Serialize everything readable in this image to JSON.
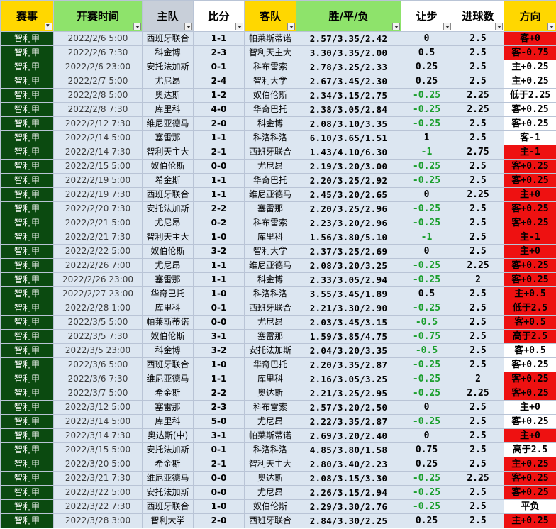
{
  "headers": [
    {
      "label": "赛事",
      "bg": "yellow",
      "filter": "active"
    },
    {
      "label": "开赛时间",
      "bg": "green",
      "filter": "normal"
    },
    {
      "label": "主队",
      "bg": "gray",
      "filter": "normal"
    },
    {
      "label": "比分",
      "bg": "white",
      "filter": "normal"
    },
    {
      "label": "客队",
      "bg": "yellow",
      "filter": "normal"
    },
    {
      "label": "胜/平/负",
      "bg": "green",
      "filter": "normal"
    },
    {
      "label": "让步",
      "bg": "white",
      "filter": "normal"
    },
    {
      "label": "进球数",
      "bg": "white",
      "filter": "normal"
    },
    {
      "label": "方向",
      "bg": "yellow",
      "filter": "normal"
    }
  ],
  "colors": {
    "league_bg": "#0b4a10",
    "row_bg": "#dce6f1",
    "dir_red": "#ee1111",
    "handicap_negative": "#1a9e2c"
  },
  "rows": [
    [
      "智利甲",
      "2022/2/6 5:00",
      "西班牙联合",
      "1-1",
      "帕莱斯蒂诺",
      "2.57/3.35/2.42",
      "0",
      "2.5",
      "客+0",
      "red"
    ],
    [
      "智利甲",
      "2022/2/6 7:30",
      "科金博",
      "2-3",
      "智利天主大",
      "3.30/3.35/2.00",
      "0.5",
      "2.5",
      "客-0.75",
      "red"
    ],
    [
      "智利甲",
      "2022/2/6 23:00",
      "安托法加斯",
      "0-1",
      "科布雷索",
      "2.78/3.25/2.33",
      "0.25",
      "2.5",
      "主+0.25",
      "white"
    ],
    [
      "智利甲",
      "2022/2/7 5:00",
      "尤尼昂",
      "2-4",
      "智利大学",
      "2.67/3.45/2.30",
      "0.25",
      "2.5",
      "主+0.25",
      "white"
    ],
    [
      "智利甲",
      "2022/2/8 5:00",
      "奥达斯",
      "1-2",
      "奴伯伦斯",
      "2.34/3.15/2.75",
      "-0.25",
      "2.25",
      "低于2.25",
      "white"
    ],
    [
      "智利甲",
      "2022/2/8 7:30",
      "库里科",
      "4-0",
      "华奇巴托",
      "2.38/3.05/2.84",
      "-0.25",
      "2.25",
      "客+0.25",
      "white"
    ],
    [
      "智利甲",
      "2022/2/12 7:30",
      "维尼亚德马",
      "2-0",
      "科金博",
      "2.08/3.10/3.35",
      "-0.25",
      "2.5",
      "客+0.25",
      "white"
    ],
    [
      "智利甲",
      "2022/2/14 5:00",
      "塞雷那",
      "1-1",
      "科洛科洛",
      "6.10/3.65/1.51",
      "1",
      "2.5",
      "客-1",
      "white"
    ],
    [
      "智利甲",
      "2022/2/14 7:30",
      "智利天主大",
      "2-1",
      "西班牙联合",
      "1.43/4.10/6.30",
      "-1",
      "2.75",
      "主-1",
      "red"
    ],
    [
      "智利甲",
      "2022/2/15 5:00",
      "奴伯伦斯",
      "0-0",
      "尤尼昂",
      "2.19/3.20/3.00",
      "-0.25",
      "2.5",
      "客+0.25",
      "red"
    ],
    [
      "智利甲",
      "2022/2/19 5:00",
      "希金斯",
      "1-1",
      "华奇巴托",
      "2.20/3.25/2.92",
      "-0.25",
      "2.5",
      "客+0.25",
      "red"
    ],
    [
      "智利甲",
      "2022/2/19 7:30",
      "西班牙联合",
      "1-1",
      "维尼亚德马",
      "2.45/3.20/2.65",
      "0",
      "2.25",
      "主+0",
      "red"
    ],
    [
      "智利甲",
      "2022/2/20 7:30",
      "安托法加斯",
      "2-2",
      "塞雷那",
      "2.20/3.25/2.96",
      "-0.25",
      "2.5",
      "客+0.25",
      "red"
    ],
    [
      "智利甲",
      "2022/2/21 5:00",
      "尤尼昂",
      "0-2",
      "科布雷索",
      "2.23/3.20/2.96",
      "-0.25",
      "2.5",
      "客+0.25",
      "red"
    ],
    [
      "智利甲",
      "2022/2/21 7:30",
      "智利天主大",
      "1-0",
      "库里科",
      "1.56/3.80/5.10",
      "-1",
      "2.5",
      "主-1",
      "red"
    ],
    [
      "智利甲",
      "2022/2/22 5:00",
      "奴伯伦斯",
      "3-2",
      "智利大学",
      "2.37/3.25/2.69",
      "0",
      "2.5",
      "主+0",
      "red"
    ],
    [
      "智利甲",
      "2022/2/26 7:00",
      "尤尼昂",
      "1-1",
      "维尼亚德马",
      "2.08/3.20/3.25",
      "-0.25",
      "2.25",
      "客+0.25",
      "red"
    ],
    [
      "智利甲",
      "2022/2/26 23:00",
      "塞雷那",
      "1-1",
      "科金博",
      "2.33/3.05/2.94",
      "-0.25",
      "2",
      "客+0.25",
      "red"
    ],
    [
      "智利甲",
      "2022/2/27 23:00",
      "华奇巴托",
      "1-0",
      "科洛科洛",
      "3.55/3.45/1.89",
      "0.5",
      "2.5",
      "主+0.5",
      "red"
    ],
    [
      "智利甲",
      "2022/2/28 1:00",
      "库里科",
      "0-1",
      "西班牙联合",
      "2.21/3.30/2.90",
      "-0.25",
      "2.5",
      "低于2.5",
      "red"
    ],
    [
      "智利甲",
      "2022/3/5 5:00",
      "帕莱斯蒂诺",
      "0-0",
      "尤尼昂",
      "2.03/3.45/3.15",
      "-0.5",
      "2.5",
      "客+0.5",
      "red"
    ],
    [
      "智利甲",
      "2022/3/5 7:30",
      "奴伯伦斯",
      "3-1",
      "塞雷那",
      "1.59/3.85/4.75",
      "-0.75",
      "2.5",
      "高于2.5",
      "red"
    ],
    [
      "智利甲",
      "2022/3/5 23:00",
      "科金博",
      "3-2",
      "安托法加斯",
      "2.04/3.20/3.35",
      "-0.5",
      "2.5",
      "客+0.5",
      "white"
    ],
    [
      "智利甲",
      "2022/3/6 5:00",
      "西班牙联合",
      "1-0",
      "华奇巴托",
      "2.20/3.35/2.87",
      "-0.25",
      "2.5",
      "客+0.25",
      "white"
    ],
    [
      "智利甲",
      "2022/3/6 7:30",
      "维尼亚德马",
      "1-1",
      "库里科",
      "2.16/3.05/3.25",
      "-0.25",
      "2",
      "客+0.25",
      "red"
    ],
    [
      "智利甲",
      "2022/3/7 5:00",
      "希金斯",
      "2-2",
      "奥达斯",
      "2.21/3.25/2.95",
      "-0.25",
      "2.25",
      "客+0.25",
      "red"
    ],
    [
      "智利甲",
      "2022/3/12 5:00",
      "塞雷那",
      "2-3",
      "科布雷索",
      "2.57/3.20/2.50",
      "0",
      "2.5",
      "主+0",
      "white"
    ],
    [
      "智利甲",
      "2022/3/14 5:00",
      "库里科",
      "5-0",
      "尤尼昂",
      "2.22/3.35/2.87",
      "-0.25",
      "2.5",
      "客+0.25",
      "white"
    ],
    [
      "智利甲",
      "2022/3/14 7:30",
      "奥达斯(中)",
      "3-1",
      "帕莱斯蒂诺",
      "2.69/3.20/2.40",
      "0",
      "2.5",
      "主+0",
      "red"
    ],
    [
      "智利甲",
      "2022/3/15 5:00",
      "安托法加斯",
      "0-1",
      "科洛科洛",
      "4.85/3.80/1.58",
      "0.75",
      "2.5",
      "高于2.5",
      "white"
    ],
    [
      "智利甲",
      "2022/3/20 5:00",
      "希金斯",
      "2-1",
      "智利天主大",
      "2.80/3.40/2.23",
      "0.25",
      "2.5",
      "主+0.25",
      "red"
    ],
    [
      "智利甲",
      "2022/3/21 7:30",
      "维尼亚德马",
      "0-0",
      "奥达斯",
      "2.08/3.15/3.30",
      "-0.25",
      "2.25",
      "客+0.25",
      "red"
    ],
    [
      "智利甲",
      "2022/3/22 5:00",
      "安托法加斯",
      "0-0",
      "尤尼昂",
      "2.26/3.15/2.94",
      "-0.25",
      "2.5",
      "客+0.25",
      "red"
    ],
    [
      "智利甲",
      "2022/3/22 7:30",
      "西班牙联合",
      "1-0",
      "奴伯伦斯",
      "2.29/3.30/2.76",
      "-0.25",
      "2.5",
      "平负",
      "white"
    ],
    [
      "智利甲",
      "2022/3/28 3:00",
      "智利大学",
      "2-0",
      "西班牙联合",
      "2.84/3.30/2.25",
      "0.25",
      "2.5",
      "主+0.25",
      "red"
    ]
  ]
}
